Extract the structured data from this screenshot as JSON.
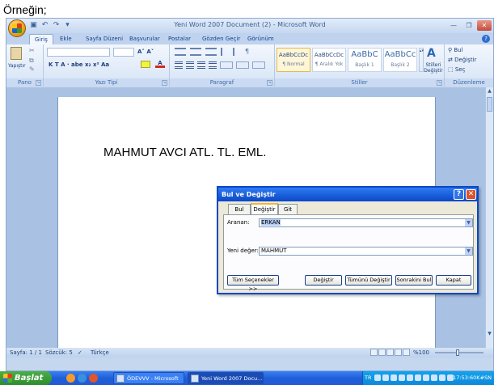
{
  "caption": "Örneğin;",
  "window": {
    "title": "Yeni Word 2007 Document (2) - Microsoft Word",
    "quick_access": [
      "save-icon",
      "undo-icon",
      "redo-icon",
      "customize-icon"
    ]
  },
  "tabs": [
    "Giriş",
    "Ekle",
    "Sayfa Düzeni",
    "Başvurular",
    "Postalar",
    "Gözden Geçir",
    "Görünüm"
  ],
  "active_tab": "Giriş",
  "ribbon": {
    "groups": {
      "clipboard": "Pano",
      "font": "Yazı Tipi",
      "paragraph": "Paragraf",
      "styles": "Stiller",
      "editing": "Düzenleme"
    },
    "paste_label": "Yapıştır",
    "font_tools": "K  T  A · abe  x₂  x²  Aa",
    "grow_shrink": "A˄ A˅",
    "styles": [
      {
        "sample": "AaBbCcDc",
        "name": "¶ Normal"
      },
      {
        "sample": "AaBbCcDc",
        "name": "¶ Aralık Yok"
      },
      {
        "sample": "AaBbC",
        "name": "Başlık 1"
      },
      {
        "sample": "AaBbCc",
        "name": "Başlık 2"
      }
    ],
    "change_styles": "Stilleri Değiştir",
    "find": "Bul",
    "replace": "Değiştir",
    "select": "Seç"
  },
  "document": {
    "text": "MAHMUT AVCI ATL. TL. EML."
  },
  "dialog": {
    "title": "Bul ve Değiştir",
    "tabs": [
      "Bul",
      "Değiştir",
      "Git"
    ],
    "active_tab": "Değiştir",
    "find_label": "Aranan:",
    "find_value": "ERKAN",
    "replace_label": "Yeni değer:",
    "replace_value": "MAHMUT",
    "buttons": {
      "more": "Tüm Seçenekler >>",
      "replace": "Değiştir",
      "replace_all": "Tümünü Değiştir",
      "find_next": "Sonrakini Bul",
      "close": "Kapat"
    }
  },
  "status": {
    "page": "Sayfa: 1 / 1",
    "words": "Sözcük: 5",
    "language": "Türkçe",
    "zoom": "%100"
  },
  "taskbar": {
    "start": "Başlat",
    "tasks": [
      "ÖDEVVV - Microsoft ...",
      "Yeni Word 2007 Docu..."
    ],
    "lang": "TR",
    "clock": "17:53:60K#SN"
  }
}
